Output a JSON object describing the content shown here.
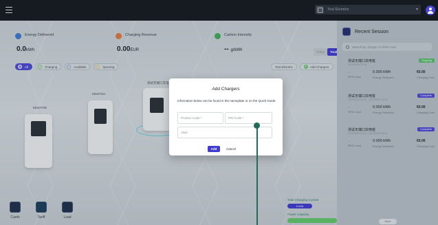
{
  "header": {
    "site_name": "Test Elemtrix",
    "icons": [
      "menu-icon",
      "site-icon",
      "chevron-down-icon",
      "avatar-icon"
    ]
  },
  "stats": {
    "energy": {
      "label": "Energy Delivered",
      "value": "0.0",
      "unit": "kWh"
    },
    "revenue": {
      "label": "Charging Revenue",
      "value": "0.00",
      "unit": "EUR"
    },
    "carbon": {
      "label": "Carbon Intensity",
      "value": "--",
      "unit": "g/kWh"
    },
    "range": {
      "today": "Today",
      "total": "Total"
    }
  },
  "filters": [
    "All",
    "Charging",
    "Available",
    "Queuing"
  ],
  "scene_buttons": {
    "site": "Test Elemtrix",
    "add": "Add Chargers"
  },
  "chargers": [
    {
      "label": "EB407DB"
    },
    {
      "label": "EB407DA"
    },
    {
      "label": "测试无端口充电桩"
    }
  ],
  "bottom_nav": [
    "Cards",
    "Tariff",
    "Load"
  ],
  "pager": {
    "prev": "‹",
    "current": "1",
    "next": "›"
  },
  "capacity": {
    "current_label": "Total Charging Current",
    "current_value": "0.00A",
    "power_label": "Power Capacity"
  },
  "recent": {
    "title": "Recent Session",
    "search_placeholder": "Search by charger or RFID card",
    "sessions": [
      {
        "name": "测试无端口充电桩",
        "sub": "2023/00/00 00:00",
        "badge": "Ongoing",
        "dash": "--",
        "card": "RFID Card",
        "kwh": "0.000 kWh",
        "ed": "Energy Delivered",
        "eur": "€0.00",
        "cc": "Charging Cost"
      },
      {
        "name": "测试无端口充电桩",
        "sub": "2023/00/00 00:00 - 2023/00/00 00:00",
        "badge": "Complete",
        "dash": "--",
        "card": "RFID Card",
        "kwh": "0.000 kWh",
        "ed": "Energy Delivered",
        "eur": "€0.00",
        "cc": "Charging Cost"
      },
      {
        "name": "测试无端口充电桩",
        "sub": "2023/00/00 00:00 - 2023/00/00 00:00",
        "badge": "Complete",
        "dash": "--",
        "card": "RFID Card",
        "kwh": "0.000 kWh",
        "ed": "Energy Delivered",
        "eur": "€0.00",
        "cc": "Charging Cost"
      }
    ],
    "more": "More"
  },
  "dialog": {
    "title": "Add Chargers",
    "info": "Information below can be found in the nameplate or on the Quick Guide.",
    "product_code_placeholder": "Product Code *",
    "pin_code_placeholder": "PIN Code *",
    "alias_placeholder": "Alias",
    "add_label": "Add",
    "cancel_label": "Cancel"
  },
  "colors": {
    "accent": "#3f3bd1",
    "topbar": "#161b22",
    "ongoing": "#55c06a",
    "pointer": "#1f6a5b"
  }
}
